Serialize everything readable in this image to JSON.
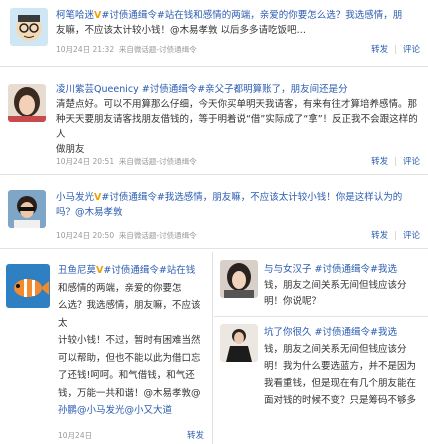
{
  "posts": [
    {
      "name": "柯笔哈迷",
      "badge": "V",
      "text_lines": [
        "#讨债通缉令#站在钱和感情的两端，亲爱的你要怎么选？我选感情，朋",
        "友嘛，不应该太计较小钱！@木易孝敦 以后多多请吃饭吧…"
      ],
      "time": "10月24日 21:32",
      "source": "来自微话题-讨债通缉令",
      "actions": [
        "转发",
        "评论"
      ]
    },
    {
      "name": "凌川紫芸Queenicy",
      "text_lines": [
        "#讨债通缉令#亲父子都明算账了，朋友间还是分",
        "清楚点好。可以不用算那么仔细，今天你买单明天我请客，有来有往才算培养感情。那",
        "种天天要朋友请客找朋友借钱的，等于明着说“借”实际成了“拿”！反正我不会跟这样的人",
        "做朋友"
      ],
      "time": "10月24日 20:51",
      "source": "来自微话题-讨债通缉令",
      "actions": [
        "转发",
        "评论"
      ]
    },
    {
      "name": "小马发光",
      "badge": "V",
      "text_lines": [
        "#讨债通缉令#我选感情，朋友嘛，不应该太计较小钱！你是这样认为的",
        "吗？@木易孝敦"
      ],
      "time": "10月24日 20:50",
      "source": "来自微话题-讨债通缉令",
      "actions": [
        "转发",
        "评论"
      ]
    },
    {
      "name": "丑鱼尼莫",
      "badge": "V",
      "text_lines": [
        "#讨债通缉令#站在钱",
        "和感情的两端，亲爱的你要怎",
        "么选？我选感情，朋友嘛，不应该太",
        "计较小钱！不过，暂时有困难当然",
        "可以帮助，但也不能以此为借口忘",
        "了还钱!呵呵。和气借钱，和气还",
        "钱，万能一共和谐！@木易孝敦@",
        "孙鹏@小马发光@小又大道"
      ],
      "time": "10月24日",
      "actions": [
        "转发"
      ]
    },
    {
      "name": "与与女汉子",
      "text_lines": [
        "#讨债通缉令#我选",
        "钱，朋友之间关系无间但钱应该分",
        "明！你说呢？"
      ],
      "actions": []
    },
    {
      "name": "坑了你很久",
      "text_lines": [
        "#讨债通缉令#我选",
        "钱，朋友之间关系无间但钱应该分",
        "明！我为什么要选蓝方，并不是因为",
        "我看重钱，但是现在有几个朋友能在",
        "面对钱的时候不变？只是筹码不够多"
      ],
      "actions": []
    }
  ]
}
